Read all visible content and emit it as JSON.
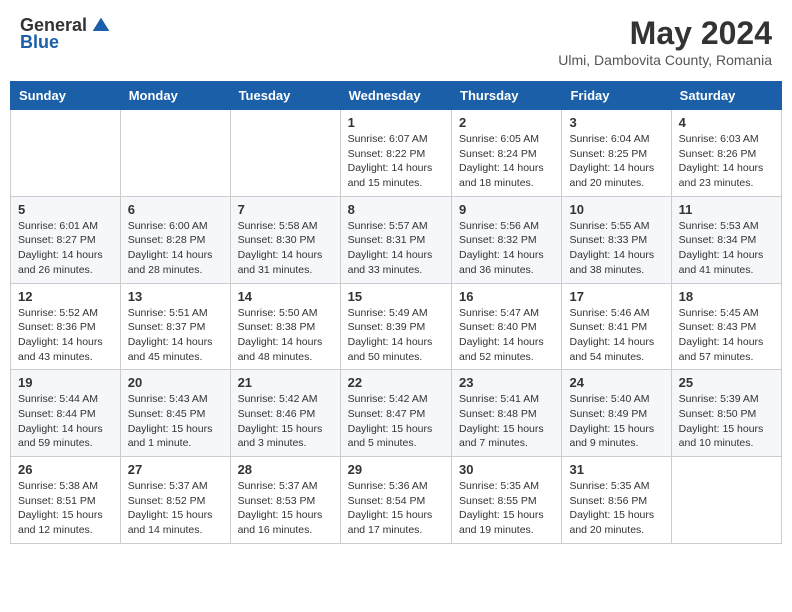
{
  "header": {
    "logo_general": "General",
    "logo_blue": "Blue",
    "month_year": "May 2024",
    "location": "Ulmi, Dambovita County, Romania"
  },
  "weekdays": [
    "Sunday",
    "Monday",
    "Tuesday",
    "Wednesday",
    "Thursday",
    "Friday",
    "Saturday"
  ],
  "weeks": [
    [
      {
        "day": "",
        "info": ""
      },
      {
        "day": "",
        "info": ""
      },
      {
        "day": "",
        "info": ""
      },
      {
        "day": "1",
        "info": "Sunrise: 6:07 AM\nSunset: 8:22 PM\nDaylight: 14 hours\nand 15 minutes."
      },
      {
        "day": "2",
        "info": "Sunrise: 6:05 AM\nSunset: 8:24 PM\nDaylight: 14 hours\nand 18 minutes."
      },
      {
        "day": "3",
        "info": "Sunrise: 6:04 AM\nSunset: 8:25 PM\nDaylight: 14 hours\nand 20 minutes."
      },
      {
        "day": "4",
        "info": "Sunrise: 6:03 AM\nSunset: 8:26 PM\nDaylight: 14 hours\nand 23 minutes."
      }
    ],
    [
      {
        "day": "5",
        "info": "Sunrise: 6:01 AM\nSunset: 8:27 PM\nDaylight: 14 hours\nand 26 minutes."
      },
      {
        "day": "6",
        "info": "Sunrise: 6:00 AM\nSunset: 8:28 PM\nDaylight: 14 hours\nand 28 minutes."
      },
      {
        "day": "7",
        "info": "Sunrise: 5:58 AM\nSunset: 8:30 PM\nDaylight: 14 hours\nand 31 minutes."
      },
      {
        "day": "8",
        "info": "Sunrise: 5:57 AM\nSunset: 8:31 PM\nDaylight: 14 hours\nand 33 minutes."
      },
      {
        "day": "9",
        "info": "Sunrise: 5:56 AM\nSunset: 8:32 PM\nDaylight: 14 hours\nand 36 minutes."
      },
      {
        "day": "10",
        "info": "Sunrise: 5:55 AM\nSunset: 8:33 PM\nDaylight: 14 hours\nand 38 minutes."
      },
      {
        "day": "11",
        "info": "Sunrise: 5:53 AM\nSunset: 8:34 PM\nDaylight: 14 hours\nand 41 minutes."
      }
    ],
    [
      {
        "day": "12",
        "info": "Sunrise: 5:52 AM\nSunset: 8:36 PM\nDaylight: 14 hours\nand 43 minutes."
      },
      {
        "day": "13",
        "info": "Sunrise: 5:51 AM\nSunset: 8:37 PM\nDaylight: 14 hours\nand 45 minutes."
      },
      {
        "day": "14",
        "info": "Sunrise: 5:50 AM\nSunset: 8:38 PM\nDaylight: 14 hours\nand 48 minutes."
      },
      {
        "day": "15",
        "info": "Sunrise: 5:49 AM\nSunset: 8:39 PM\nDaylight: 14 hours\nand 50 minutes."
      },
      {
        "day": "16",
        "info": "Sunrise: 5:47 AM\nSunset: 8:40 PM\nDaylight: 14 hours\nand 52 minutes."
      },
      {
        "day": "17",
        "info": "Sunrise: 5:46 AM\nSunset: 8:41 PM\nDaylight: 14 hours\nand 54 minutes."
      },
      {
        "day": "18",
        "info": "Sunrise: 5:45 AM\nSunset: 8:43 PM\nDaylight: 14 hours\nand 57 minutes."
      }
    ],
    [
      {
        "day": "19",
        "info": "Sunrise: 5:44 AM\nSunset: 8:44 PM\nDaylight: 14 hours\nand 59 minutes."
      },
      {
        "day": "20",
        "info": "Sunrise: 5:43 AM\nSunset: 8:45 PM\nDaylight: 15 hours\nand 1 minute."
      },
      {
        "day": "21",
        "info": "Sunrise: 5:42 AM\nSunset: 8:46 PM\nDaylight: 15 hours\nand 3 minutes."
      },
      {
        "day": "22",
        "info": "Sunrise: 5:42 AM\nSunset: 8:47 PM\nDaylight: 15 hours\nand 5 minutes."
      },
      {
        "day": "23",
        "info": "Sunrise: 5:41 AM\nSunset: 8:48 PM\nDaylight: 15 hours\nand 7 minutes."
      },
      {
        "day": "24",
        "info": "Sunrise: 5:40 AM\nSunset: 8:49 PM\nDaylight: 15 hours\nand 9 minutes."
      },
      {
        "day": "25",
        "info": "Sunrise: 5:39 AM\nSunset: 8:50 PM\nDaylight: 15 hours\nand 10 minutes."
      }
    ],
    [
      {
        "day": "26",
        "info": "Sunrise: 5:38 AM\nSunset: 8:51 PM\nDaylight: 15 hours\nand 12 minutes."
      },
      {
        "day": "27",
        "info": "Sunrise: 5:37 AM\nSunset: 8:52 PM\nDaylight: 15 hours\nand 14 minutes."
      },
      {
        "day": "28",
        "info": "Sunrise: 5:37 AM\nSunset: 8:53 PM\nDaylight: 15 hours\nand 16 minutes."
      },
      {
        "day": "29",
        "info": "Sunrise: 5:36 AM\nSunset: 8:54 PM\nDaylight: 15 hours\nand 17 minutes."
      },
      {
        "day": "30",
        "info": "Sunrise: 5:35 AM\nSunset: 8:55 PM\nDaylight: 15 hours\nand 19 minutes."
      },
      {
        "day": "31",
        "info": "Sunrise: 5:35 AM\nSunset: 8:56 PM\nDaylight: 15 hours\nand 20 minutes."
      },
      {
        "day": "",
        "info": ""
      }
    ]
  ]
}
